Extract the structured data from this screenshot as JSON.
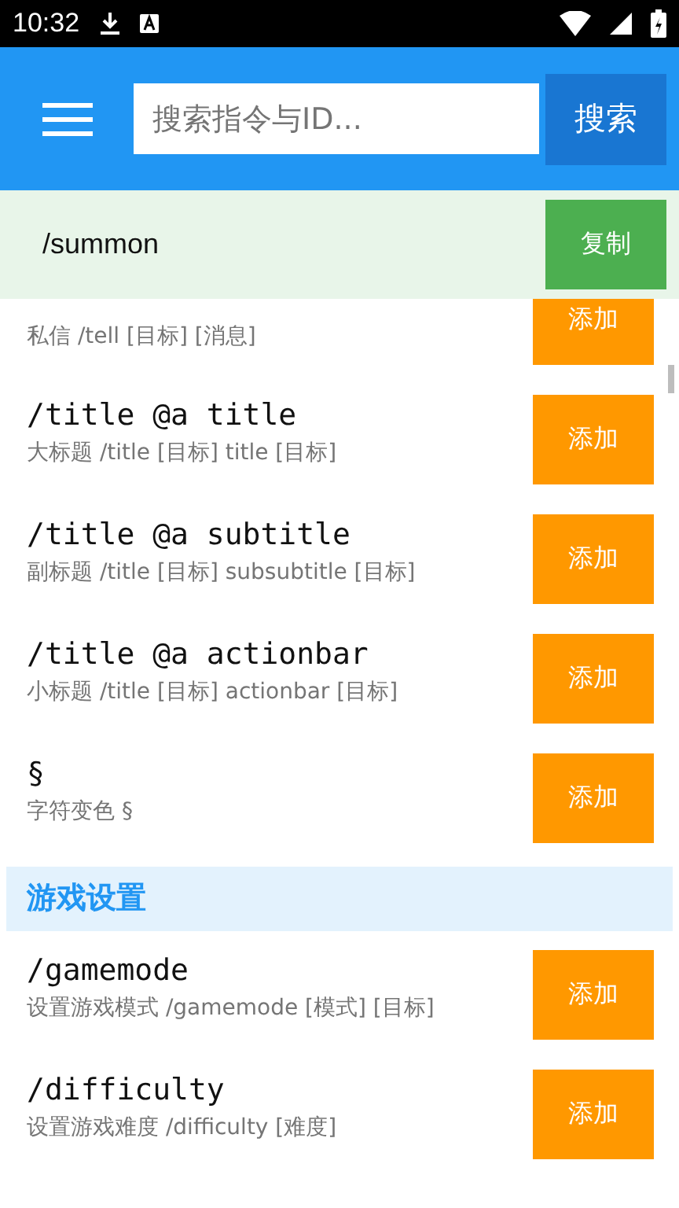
{
  "status_bar": {
    "time": "10:32"
  },
  "search": {
    "placeholder": "搜索指令与ID...",
    "button": "搜索"
  },
  "current": {
    "command": "/summon",
    "button": "复制"
  },
  "list": [
    {
      "kind": "command",
      "description": "私信 /tell [目标] [消息]",
      "button": "添加"
    },
    {
      "kind": "command",
      "title": "/title @a title",
      "description": "大标题 /title [目标] title [目标]",
      "button": "添加"
    },
    {
      "kind": "command",
      "title": "/title @a subtitle",
      "description": "副标题 /title [目标] subsubtitle [目标]",
      "button": "添加"
    },
    {
      "kind": "command",
      "title": "/title @a actionbar",
      "description": "小标题 /title [目标] actionbar [目标]",
      "button": "添加"
    },
    {
      "kind": "command",
      "title": "§",
      "description": "字符变色 §",
      "button": "添加"
    },
    {
      "kind": "section",
      "title": "游戏设置"
    },
    {
      "kind": "command",
      "title": "/gamemode",
      "description": "设置游戏模式 /gamemode [模式] [目标]",
      "button": "添加"
    },
    {
      "kind": "command",
      "title": "/difficulty",
      "description": "设置游戏难度 /difficulty [难度]",
      "button": "添加"
    }
  ]
}
